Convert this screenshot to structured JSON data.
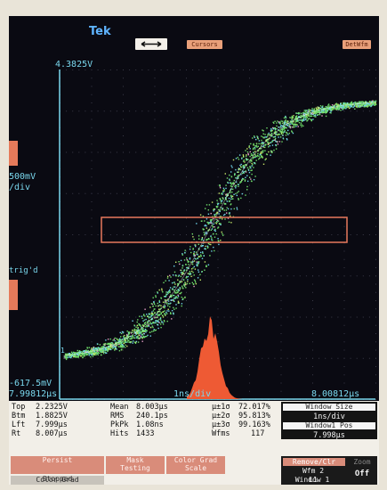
{
  "header": {
    "brand": "Tek",
    "cursors_label": "Cursors",
    "right_label": "DetWfm"
  },
  "scale": {
    "top_level": "4.3825V",
    "volts_per_div": "500mV",
    "per_div": "/div",
    "trigd": "trig'd",
    "bottom_level": "-617.5mV",
    "time_left": "7.99812µs",
    "time_per_div": "1ns/div",
    "time_right": "8.00812µs",
    "ch_marker": "1"
  },
  "measurements": [
    {
      "label": "Top",
      "value": "2.2325V"
    },
    {
      "label": "Btm",
      "value": "1.8825V"
    },
    {
      "label": "Lft",
      "value": "7.999µs"
    },
    {
      "label": "Rt",
      "value": "8.007µs"
    }
  ],
  "stats": [
    {
      "label": "Mean",
      "value": "8.003µs"
    },
    {
      "label": "RMS",
      "value": "240.1ps"
    },
    {
      "label": "PkPk",
      "value": "1.08ns"
    },
    {
      "label": "Hits",
      "value": "1433"
    }
  ],
  "sigma": [
    {
      "label": "µ±1σ",
      "value": "72.017%"
    },
    {
      "label": "µ±2σ",
      "value": "95.813%"
    },
    {
      "label": "µ±3σ",
      "value": "99.163%"
    },
    {
      "label": "Wfms",
      "value": "117"
    }
  ],
  "side_menu": {
    "window_size": "Window Size",
    "window_size_value": "1ns/div",
    "window_pos": "Window1 Pos",
    "window_pos_value": "7.998µs",
    "remove_clr": "Remove/Clr",
    "wfm": "Wfm 2",
    "zoom": "Zoom",
    "zoom_value": "Off",
    "l1": "L1",
    "window1": "Window 1"
  },
  "menu": {
    "persist": "Persist",
    "mask": "Mask",
    "testing": "Testing",
    "color_grad": "Color Grad",
    "scale": "Scale",
    "color_grad2": "Color Grad",
    "stopped": "Stopped"
  },
  "colors": {
    "accent": "#e87a58",
    "cyan": "#7ad8ee",
    "histogram": "#ee5a34",
    "window_box": "#e8795c"
  }
}
